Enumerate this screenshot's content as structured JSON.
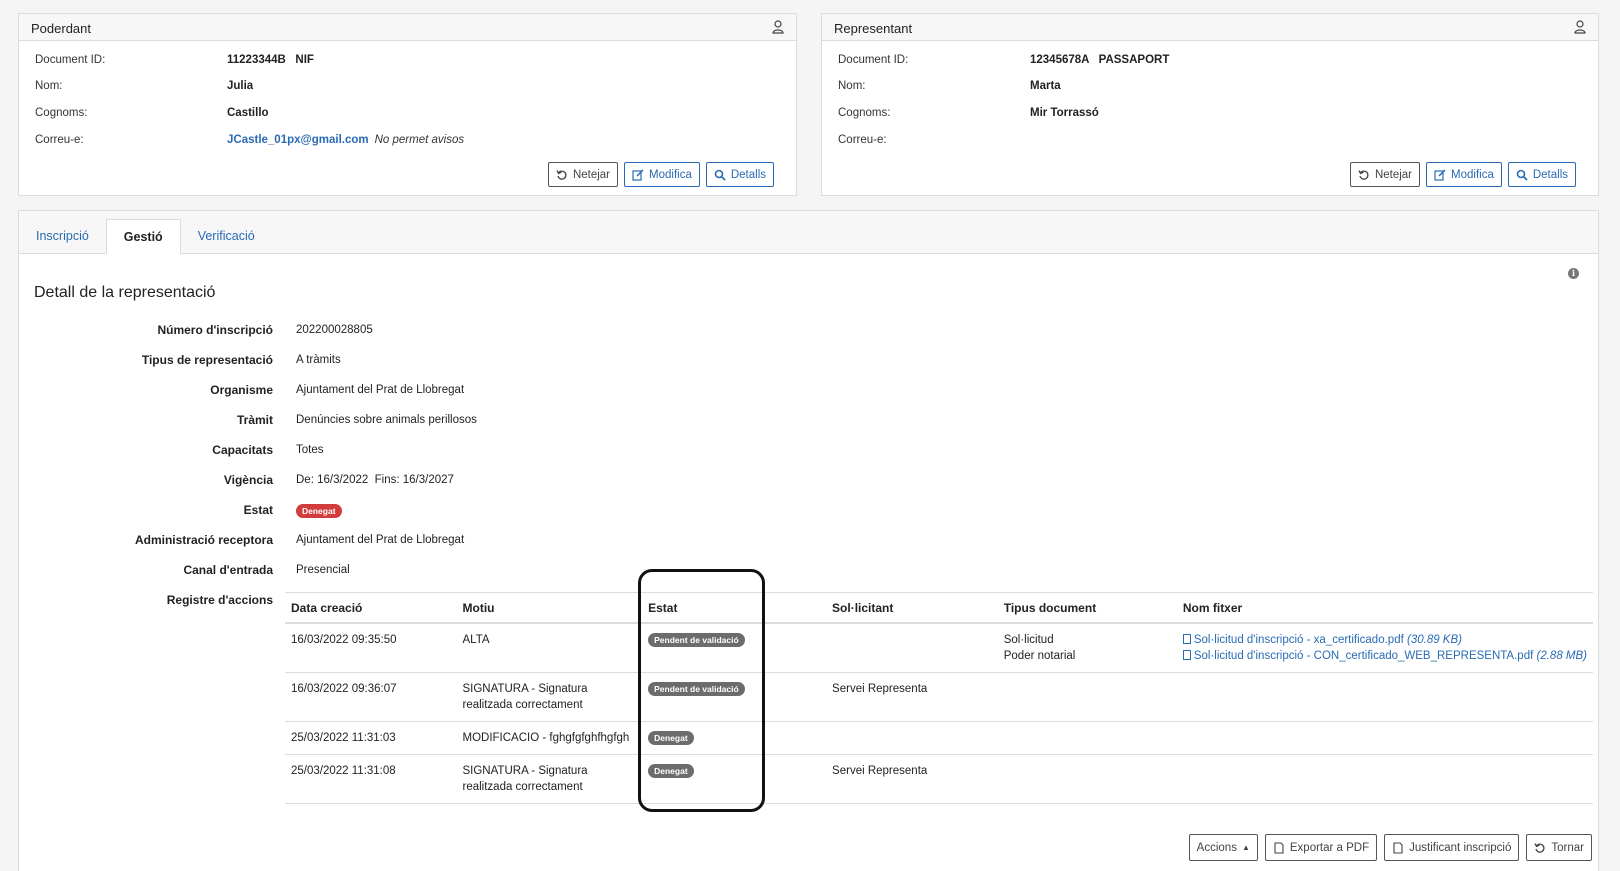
{
  "poderdant": {
    "title": "Poderdant",
    "document_id_label": "Document ID:",
    "document_id_value": "11223344B   NIF",
    "nom_label": "Nom:",
    "nom_value": "Julia",
    "cognoms_label": "Cognoms:",
    "cognoms_value": "Castillo",
    "correu_label": "Correu-e:",
    "correu_value": "JCastle_01px@gmail.com",
    "correu_note": "No permet avisos",
    "buttons": {
      "netejar": "Netejar",
      "modifica": "Modifica",
      "detalls": "Detalls"
    }
  },
  "representant": {
    "title": "Representant",
    "document_id_label": "Document ID:",
    "document_id_value": "12345678A   PASSAPORT",
    "nom_label": "Nom:",
    "nom_value": "Marta",
    "cognoms_label": "Cognoms:",
    "cognoms_value": "Mir Torrassó",
    "correu_label": "Correu-e:",
    "buttons": {
      "netejar": "Netejar",
      "modifica": "Modifica",
      "detalls": "Detalls"
    }
  },
  "tabs": [
    "Inscripció",
    "Gestió",
    "Verificació"
  ],
  "detail": {
    "title": "Detall de la representació",
    "fields": [
      {
        "label": "Número d'inscripció",
        "value": "202200028805"
      },
      {
        "label": "Tipus de representació",
        "value": "A tràmits"
      },
      {
        "label": "Organisme",
        "value": "Ajuntament del Prat de Llobregat"
      },
      {
        "label": "Tràmit",
        "value": "Denúncies sobre animals perillosos"
      },
      {
        "label": "Capacitats",
        "value": "Totes"
      },
      {
        "label": "Vigència",
        "value": "De: 16/3/2022  Fins: 16/3/2027"
      },
      {
        "label": "Estat",
        "value": "Denegat"
      },
      {
        "label": "Administració receptora",
        "value": "Ajuntament del Prat de Llobregat"
      },
      {
        "label": "Canal d'entrada",
        "value": "Presencial"
      },
      {
        "label": "Registre d'accions",
        "value": ""
      }
    ]
  },
  "log": {
    "headers": [
      "Data creació",
      "Motiu",
      "Estat",
      "Sol·licitant",
      "Tipus document",
      "Nom fitxer"
    ],
    "rows": [
      {
        "date": "16/03/2022 09:35:50",
        "motiu": "ALTA",
        "estat": "Pendent de validació",
        "sollicitant": "",
        "tipus": [
          "Sol·licitud",
          "Poder notarial"
        ],
        "files": [
          {
            "name": "Sol·licitud d'inscripció - xa_certificado.pdf",
            "size": "(30.89 KB)"
          },
          {
            "name": "Sol·licitud d'inscripció - CON_certificado_WEB_REPRESENTA.pdf",
            "size": "(2.88 MB)"
          }
        ]
      },
      {
        "date": "16/03/2022 09:36:07",
        "motiu": "SIGNATURA - Signatura realitzada correctament",
        "estat": "Pendent de validació",
        "sollicitant": "Servei Representa",
        "tipus": [],
        "files": []
      },
      {
        "date": "25/03/2022 11:31:03",
        "motiu": "MODIFICACIO - fghgfgfghfhgfgh",
        "estat": "Denegat",
        "sollicitant": "",
        "tipus": [],
        "files": []
      },
      {
        "date": "25/03/2022 11:31:08",
        "motiu": "SIGNATURA - Signatura realitzada correctament",
        "estat": "Denegat",
        "sollicitant": "Servei Representa",
        "tipus": [],
        "files": []
      }
    ]
  },
  "footer": {
    "accions": "Accions",
    "exportar": "Exportar a PDF",
    "justificant": "Justificant inscripció",
    "tornar": "Tornar"
  },
  "colors": {
    "link": "#2a6bb5",
    "danger_badge": "#d23c3c",
    "secondary_badge": "#6c6c6c"
  }
}
